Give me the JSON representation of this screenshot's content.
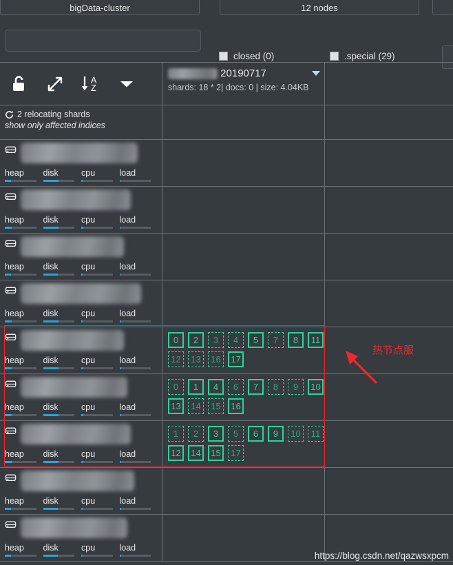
{
  "tabs": [
    {
      "label": "bigData-cluster",
      "name": "tab-cluster"
    },
    {
      "label": "12 nodes",
      "name": "tab-nodes"
    },
    {
      "label": "",
      "name": "tab-overflow"
    }
  ],
  "filters": {
    "search_value": "",
    "search_placeholder": "",
    "closed_label": "closed (0)",
    "special_label": ".special (29)"
  },
  "toolbar": {
    "unlock_icon": "unlock-icon",
    "expand_icon": "expand-arrows-icon",
    "sort_icon": "sort-az-icon",
    "menu_icon": "chevron-down-icon"
  },
  "index": {
    "title": "20190717",
    "stats": "shards: 18 * 2| docs: 0 | size: 4.04KB",
    "caret": "caret-down-icon"
  },
  "relocating": {
    "icon": "refresh-icon",
    "text": "2 relocating shards",
    "link": "show only affected indices"
  },
  "metric_labels": [
    "heap",
    "disk",
    "cpu",
    "load"
  ],
  "nodes": [
    {
      "name": "",
      "icon": "server-icon",
      "metrics": [
        20,
        50,
        5,
        4
      ],
      "shards": []
    },
    {
      "name": "",
      "icon": "server-icon",
      "metrics": [
        22,
        50,
        6,
        4
      ],
      "shards": []
    },
    {
      "name": "",
      "icon": "server-icon",
      "metrics": [
        20,
        48,
        5,
        4
      ],
      "shards": []
    },
    {
      "name": "",
      "icon": "server-icon",
      "metrics": [
        21,
        49,
        5,
        5
      ],
      "shards": []
    },
    {
      "name": "",
      "icon": "server-icon",
      "metrics": [
        22,
        50,
        6,
        5
      ],
      "shards": [
        {
          "id": "0",
          "state": "solid"
        },
        {
          "id": "2",
          "state": "solid"
        },
        {
          "id": "3",
          "state": "dashed"
        },
        {
          "id": "4",
          "state": "dashed"
        },
        {
          "id": "5",
          "state": "solid"
        },
        {
          "id": "7",
          "state": "dashed"
        },
        {
          "id": "8",
          "state": "solid"
        },
        {
          "id": "11",
          "state": "solid"
        },
        {
          "id": "12",
          "state": "dashed"
        },
        {
          "id": "13",
          "state": "dashed"
        },
        {
          "id": "16",
          "state": "dashed"
        },
        {
          "id": "17",
          "state": "solid"
        }
      ]
    },
    {
      "name": "",
      "icon": "server-icon",
      "metrics": [
        22,
        50,
        6,
        5
      ],
      "shards": [
        {
          "id": "0",
          "state": "dashed"
        },
        {
          "id": "1",
          "state": "solid"
        },
        {
          "id": "4",
          "state": "solid"
        },
        {
          "id": "6",
          "state": "dashed"
        },
        {
          "id": "7",
          "state": "solid"
        },
        {
          "id": "8",
          "state": "dashed"
        },
        {
          "id": "9",
          "state": "dashed"
        },
        {
          "id": "10",
          "state": "solid"
        },
        {
          "id": "13",
          "state": "solid"
        },
        {
          "id": "14",
          "state": "dashed"
        },
        {
          "id": "15",
          "state": "dashed"
        },
        {
          "id": "16",
          "state": "solid"
        }
      ]
    },
    {
      "name": "",
      "icon": "server-icon",
      "metrics": [
        21,
        50,
        6,
        5
      ],
      "shards": [
        {
          "id": "1",
          "state": "dashed"
        },
        {
          "id": "2",
          "state": "dashed"
        },
        {
          "id": "3",
          "state": "solid"
        },
        {
          "id": "5",
          "state": "dashed"
        },
        {
          "id": "6",
          "state": "solid"
        },
        {
          "id": "9",
          "state": "solid"
        },
        {
          "id": "10",
          "state": "dashed"
        },
        {
          "id": "11",
          "state": "dashed"
        },
        {
          "id": "12",
          "state": "solid"
        },
        {
          "id": "14",
          "state": "solid"
        },
        {
          "id": "15",
          "state": "solid"
        },
        {
          "id": "17",
          "state": "dashed"
        }
      ]
    },
    {
      "name": "",
      "icon": "server-icon",
      "metrics": [
        20,
        48,
        5,
        6
      ],
      "shards": []
    },
    {
      "name": "",
      "icon": "server-icon",
      "metrics": [
        20,
        48,
        5,
        6
      ],
      "shards": []
    }
  ],
  "annotation": {
    "text": "热节点服",
    "color": "#f0282d",
    "arrow": "arrow-up-left-icon"
  },
  "watermark": "https://blog.csdn.net/qazwsxpcm",
  "colors": {
    "background": "#363b40",
    "grid_line": "#6b7177",
    "metric_fill": "#29a3e0",
    "shard_green": "#2bd29b",
    "annotation_red": "#f0282d"
  }
}
